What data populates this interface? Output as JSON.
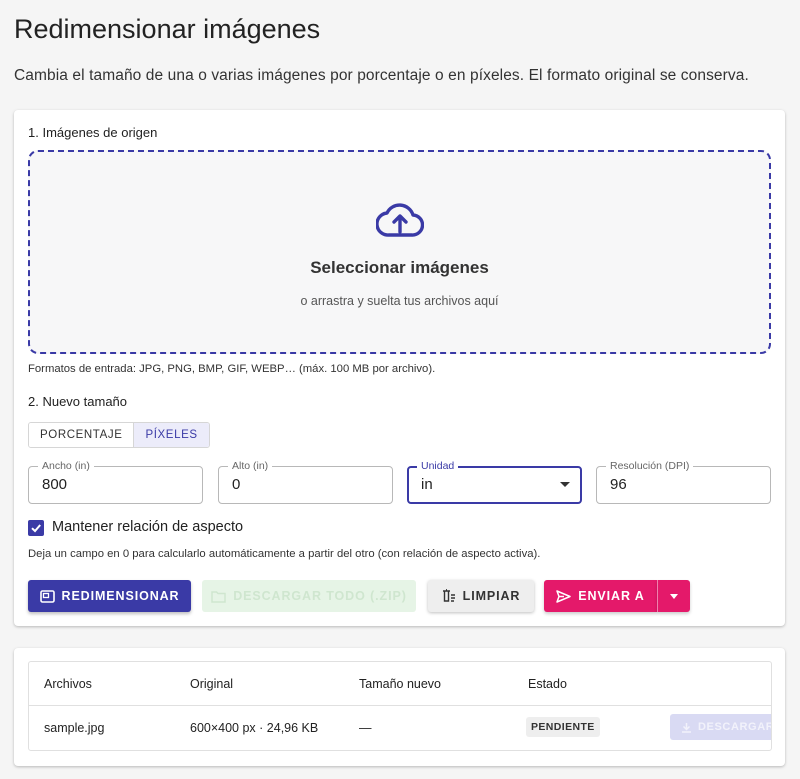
{
  "header": {
    "title": "Redimensionar imágenes",
    "subtitle": "Cambia el tamaño de una o varias imágenes por porcentaje o en píxeles. El formato original se conserva."
  },
  "source": {
    "section_title": "1. Imágenes de origen",
    "dropzone_title": "Seleccionar imágenes",
    "dropzone_hint": "o arrastra y suelta tus archivos aquí",
    "formats_note": "Formatos de entrada: JPG, PNG, BMP, GIF, WEBP… (máx. 100 MB por archivo)."
  },
  "size": {
    "section_title": "2. Nuevo tamaño",
    "modes": [
      "PORCENTAJE",
      "PÍXELES"
    ],
    "active_mode": "PÍXELES",
    "fields": {
      "width": {
        "label": "Ancho (in)",
        "value": "800"
      },
      "height": {
        "label": "Alto (in)",
        "value": "0"
      },
      "unit": {
        "label": "Unidad",
        "value": "in"
      },
      "resolution": {
        "label": "Resolución (DPI)",
        "value": "96"
      }
    },
    "keep_aspect": {
      "label": "Mantener relación de aspecto",
      "checked": true
    },
    "help_text": "Deja un campo en 0 para calcularlo automáticamente a partir del otro (con relación de aspecto activa)."
  },
  "actions": {
    "resize_label": "REDIMENSIONAR",
    "zip_label": "DESCARGAR TODO (.ZIP)",
    "clear_label": "LIMPIAR",
    "send_label": "ENVIAR A"
  },
  "table": {
    "headers": [
      "Archivos",
      "Original",
      "Tamaño nuevo",
      "Estado"
    ],
    "rows": [
      {
        "file": "sample.jpg",
        "original": "600×400 px · 24,96 KB",
        "new_size": "—",
        "status": "PENDIENTE",
        "download_label": "DESCARGAR"
      }
    ]
  },
  "colors": {
    "primary": "#3a3aa6",
    "accent": "#e4196a",
    "disabled_green": "#e6f4e6"
  }
}
